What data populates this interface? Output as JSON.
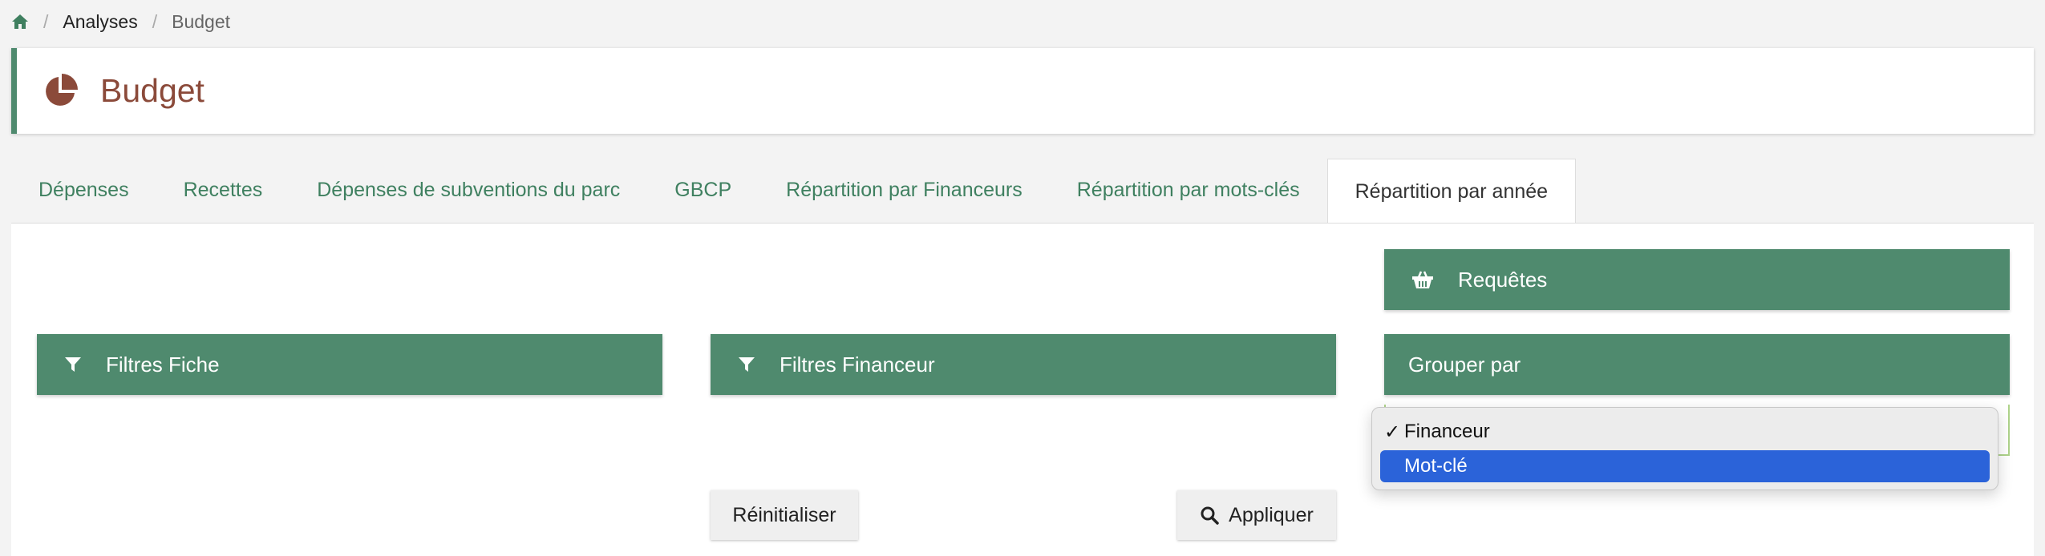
{
  "breadcrumb": {
    "items": [
      "Analyses",
      "Budget"
    ]
  },
  "page": {
    "title": "Budget",
    "title_color": "#8b4a3a",
    "accent_color": "#4f8a6e"
  },
  "tabs": [
    {
      "label": "Dépenses",
      "active": false
    },
    {
      "label": "Recettes",
      "active": false
    },
    {
      "label": "Dépenses de subventions du parc",
      "active": false
    },
    {
      "label": "GBCP",
      "active": false
    },
    {
      "label": "Répartition par Financeurs",
      "active": false
    },
    {
      "label": "Répartition par mots-clés",
      "active": false
    },
    {
      "label": "Répartition par année",
      "active": true
    }
  ],
  "panels": {
    "requetes": {
      "label": "Requêtes",
      "icon": "basket-icon"
    },
    "filtres_fiche": {
      "label": "Filtres Fiche",
      "icon": "filter-icon"
    },
    "filtres_financeur": {
      "label": "Filtres Financeur",
      "icon": "filter-icon"
    },
    "grouper_par": {
      "label": "Grouper par"
    }
  },
  "buttons": {
    "reset": "Réinitialiser",
    "apply": "Appliquer"
  },
  "group_select": {
    "options": [
      "Financeur",
      "Mot-clé"
    ],
    "selected": "Financeur",
    "highlighted": "Mot-clé",
    "check_mark": "✓",
    "highlight_color": "#2b63d9"
  }
}
